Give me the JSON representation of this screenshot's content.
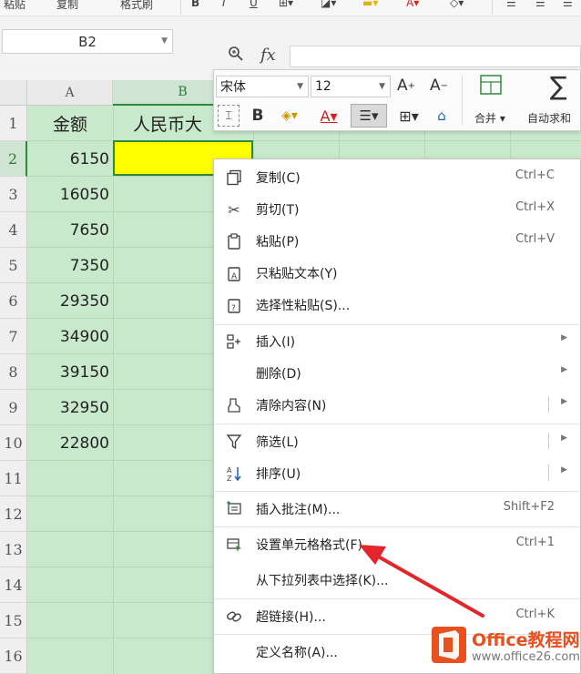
{
  "ribbon": {
    "paste": "粘贴",
    "copy": "复制",
    "format_painter": "格式刷"
  },
  "formula_bar": {
    "namebox": "B2",
    "fx": "fx"
  },
  "columns": [
    "A",
    "B"
  ],
  "rows": [
    "1",
    "2",
    "3",
    "4",
    "5",
    "6",
    "7",
    "8",
    "9",
    "10",
    "11",
    "12",
    "13",
    "14",
    "15",
    "16"
  ],
  "cells": {
    "a1": "金额",
    "b1": "人民币大",
    "amounts": [
      "6150",
      "16050",
      "7650",
      "7350",
      "29350",
      "34900",
      "39150",
      "32950",
      "22800"
    ]
  },
  "mini_toolbar": {
    "font": "宋体",
    "size": "12",
    "merge": "合并",
    "autosum": "自动求和"
  },
  "context_menu": {
    "items": [
      {
        "label": "复制(C)",
        "shortcut": "Ctrl+C",
        "icon": "copy-icon"
      },
      {
        "label": "剪切(T)",
        "shortcut": "Ctrl+X",
        "icon": "scissors-icon"
      },
      {
        "label": "粘贴(P)",
        "shortcut": "Ctrl+V",
        "icon": "clipboard-icon"
      },
      {
        "label": "只粘贴文本(Y)",
        "shortcut": "",
        "icon": "paste-text-icon"
      },
      {
        "label": "选择性粘贴(S)...",
        "shortcut": "",
        "icon": "paste-special-icon"
      },
      {
        "label": "插入(I)",
        "shortcut": "",
        "icon": "insert-icon"
      },
      {
        "label": "删除(D)",
        "shortcut": "",
        "icon": ""
      },
      {
        "label": "清除内容(N)",
        "shortcut": "",
        "icon": "eraser-icon"
      },
      {
        "label": "筛选(L)",
        "shortcut": "",
        "icon": "filter-icon"
      },
      {
        "label": "排序(U)",
        "shortcut": "",
        "icon": "sort-icon"
      },
      {
        "label": "插入批注(M)...",
        "shortcut": "Shift+F2",
        "icon": "comment-icon"
      },
      {
        "label": "设置单元格格式(F)...",
        "shortcut": "Ctrl+1",
        "icon": "format-cells-icon"
      },
      {
        "label": "从下拉列表中选择(K)...",
        "shortcut": "",
        "icon": ""
      },
      {
        "label": "超链接(H)...",
        "shortcut": "Ctrl+K",
        "icon": "link-icon"
      },
      {
        "label": "定义名称(A)...",
        "shortcut": "",
        "icon": ""
      }
    ]
  },
  "watermark": {
    "name": "Office教程网",
    "url": "www.office26.com"
  },
  "colors": {
    "cell_bg": "#c9e9cc",
    "active_fill": "#ffff00",
    "select_green": "#2f8a3c",
    "arrow": "#e3262b",
    "logo": "#e8501f"
  }
}
